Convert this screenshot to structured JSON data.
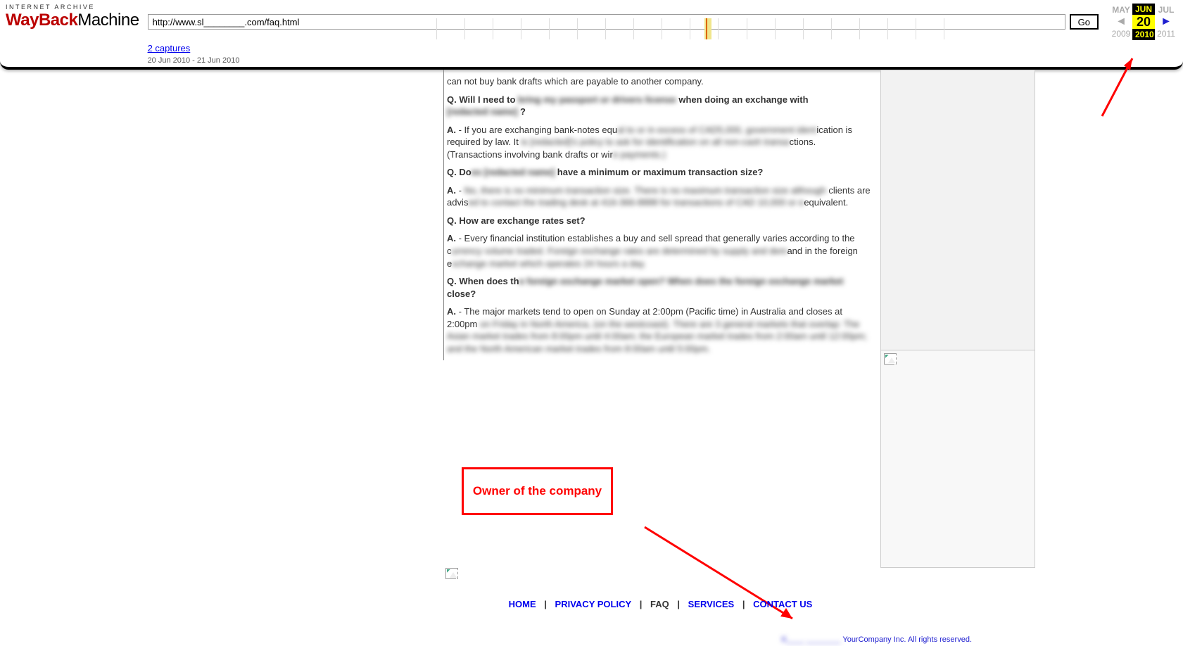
{
  "wayback": {
    "logo_top": "INTERNET ARCHIVE",
    "logo_red": "WayBack",
    "logo_black": "Machine",
    "url_value": "http://www.sl________.com/faq.html",
    "go_label": "Go",
    "captures_label": "2 captures",
    "date_range": "20 Jun 2010 - 21 Jun 2010",
    "nav": {
      "prev_month": "MAY",
      "cur_month": "JUN",
      "next_month": "JUL",
      "cur_day": "20",
      "prev_year": "2009",
      "cur_year": "2010",
      "next_year": "2011"
    }
  },
  "faq": {
    "a0_partial": "can not buy bank drafts which are payable to another company.",
    "q1_a": "Q. Will I need to",
    "q1_blur": "bring my passport or drivers license",
    "q1_b": " when doing an exchange with",
    "q1_blur2": "[redacted name]",
    "q1_c": " ?",
    "a1_a": "A.",
    "a1_b": " - If you are exchanging bank-notes equ",
    "a1_blur1": "al to or in excess of CAD5,000, government ident",
    "a1_c": "ication is required by law.  It ",
    "a1_blur2": "is [redacted]'s policy to ask for identification on all non-cash transa",
    "a1_d": "ctions. (Transactions involving bank drafts or wir",
    "a1_blur3": "e payments.)",
    "q2_a": "Q. Do",
    "q2_blur": "es [redacted name]",
    "q2_b": " have a minimum or maximum transaction size?",
    "a2_a": "A.",
    "a2_b": " - ",
    "a2_blur1": "No, there is no minimum transaction size.  There is no maximum transaction size although",
    "a2_c": " clients are advis",
    "a2_blur2": "ed to contact the trading desk at 416-366-8888 for transactions of CAD 10,000 or e",
    "a2_d": "equivalent.",
    "q3": "Q. How are exchange rates set?",
    "a3_a": "A.",
    "a3_b": " - Every financial institution establishes a buy and sell spread that generally varies according to the c",
    "a3_blur1": "urrency volume traded.  Foreign exchange rates are determined by supply and dem",
    "a3_c": "and in the foreign e",
    "a3_blur2": "xchange market which operates 24 hours a day.",
    "q4_a": "Q. When does th",
    "q4_blur": "e foreign exchange market open? When does the foreign exchange market",
    "q4_b": " close?",
    "a4_a": "A.",
    "a4_b": " - The major markets tend to open on Sunday at 2:00pm (Pacific time) in Australia and closes at 2:00pm ",
    "a4_blur": "on Friday in North America, (on the westcoast). There are 3 general markets that overlap:  The Asian market trades from 8:00pm until 4:00am; the European market  trades from 2:00am until 12:00pm; and the North American market trades from 8:00am until 5:00pm."
  },
  "annotations": {
    "owner_label": "Owner of the company"
  },
  "footer": {
    "home": "HOME",
    "privacy": "PRIVACY POLICY",
    "faq": "FAQ",
    "services": "SERVICES",
    "contact": "CONTACT US",
    "copyright_blur": "K____ ________",
    "copyright": " YourCompany Inc. All rights reserved."
  }
}
